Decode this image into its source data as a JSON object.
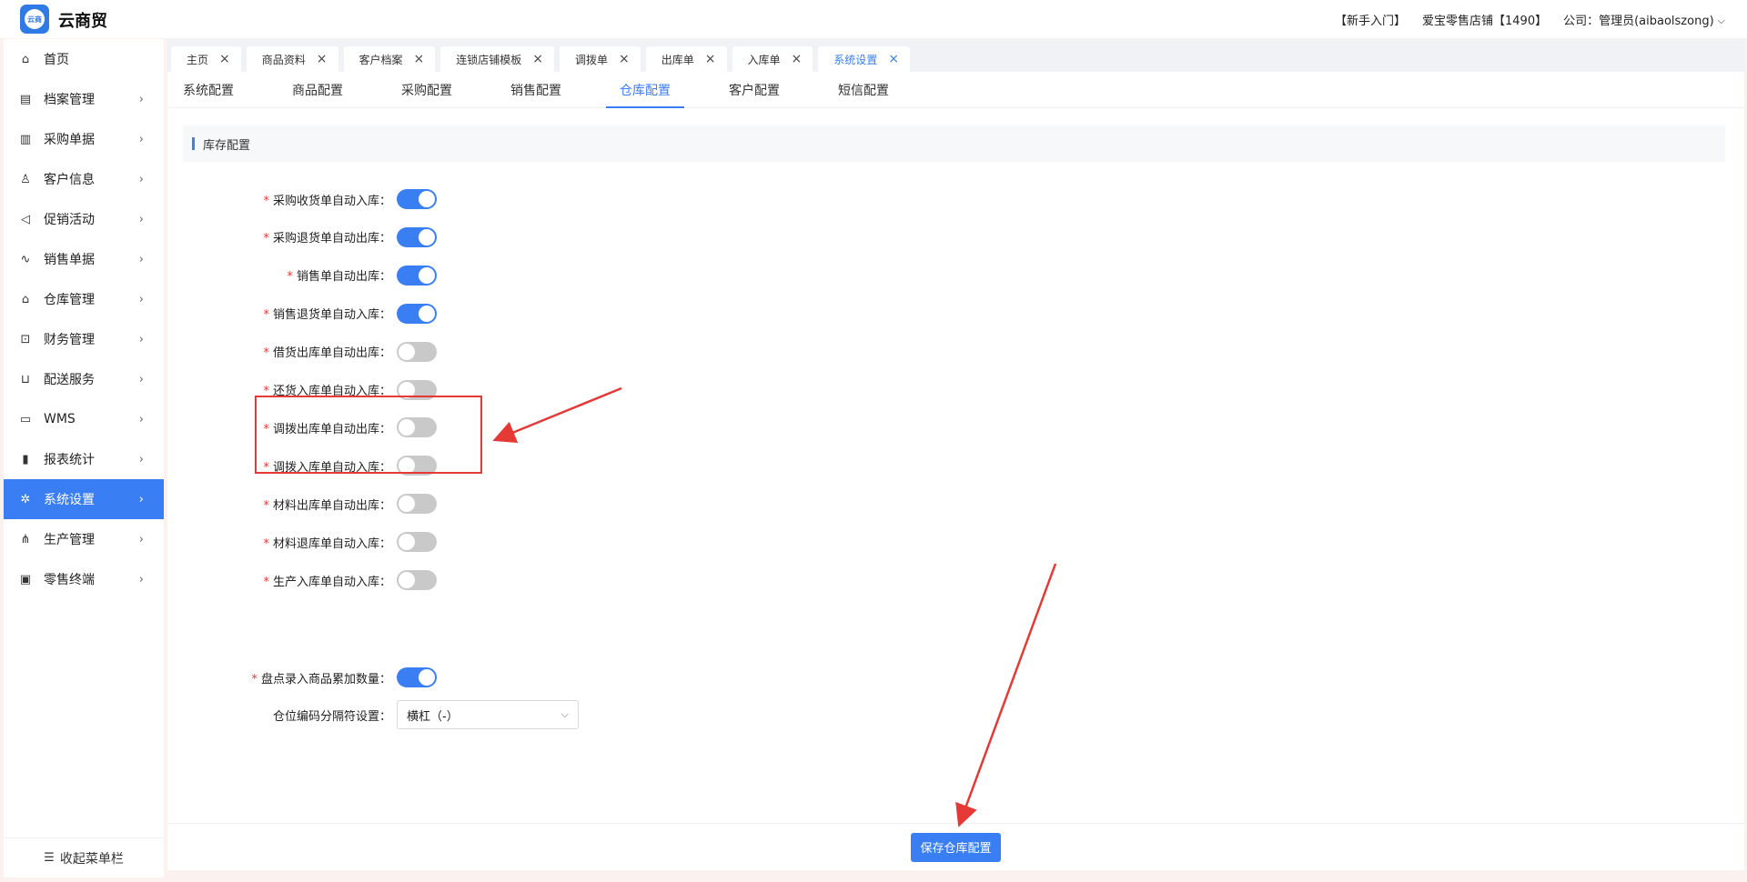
{
  "header": {
    "app_title": "云商贸",
    "logo_text": "云商",
    "newbie_link": "【新手入门】",
    "store": "爱宝零售店铺【1490】",
    "company": "公司：管理员(aibaolszong)",
    "dropdown_icon": "chevron-down-icon"
  },
  "sidebar": {
    "items": [
      {
        "label": "首页",
        "icon": "home-icon"
      },
      {
        "label": "档案管理",
        "icon": "archive-icon"
      },
      {
        "label": "采购单据",
        "icon": "purchase-doc-icon"
      },
      {
        "label": "客户信息",
        "icon": "user-icon"
      },
      {
        "label": "促销活动",
        "icon": "megaphone-icon"
      },
      {
        "label": "销售单据",
        "icon": "chart-line-icon"
      },
      {
        "label": "仓库管理",
        "icon": "warehouse-icon"
      },
      {
        "label": "财务管理",
        "icon": "finance-icon"
      },
      {
        "label": "配送服务",
        "icon": "cart-icon"
      },
      {
        "label": "WMS",
        "icon": "truck-icon"
      },
      {
        "label": "报表统计",
        "icon": "bar-chart-icon"
      },
      {
        "label": "系统设置",
        "icon": "gear-icon"
      },
      {
        "label": "生产管理",
        "icon": "network-icon"
      },
      {
        "label": "零售终端",
        "icon": "bag-icon"
      }
    ],
    "active_index": 11,
    "collapse_label": "收起菜单栏"
  },
  "tabs": [
    {
      "label": "主页"
    },
    {
      "label": "商品资料"
    },
    {
      "label": "客户档案"
    },
    {
      "label": "连锁店铺模板"
    },
    {
      "label": "调拨单"
    },
    {
      "label": "出库单"
    },
    {
      "label": "入库单"
    },
    {
      "label": "系统设置"
    }
  ],
  "active_tab": 7,
  "subtabs": [
    "系统配置",
    "商品配置",
    "采购配置",
    "销售配置",
    "仓库配置",
    "客户配置",
    "短信配置"
  ],
  "active_subtab": 4,
  "section_title": "库存配置",
  "settings": [
    {
      "label": "采购收货单自动入库：",
      "required": true,
      "on": true
    },
    {
      "label": "采购退货单自动出库：",
      "required": true,
      "on": true
    },
    {
      "label": "销售单自动出库：",
      "required": true,
      "on": true
    },
    {
      "label": "销售退货单自动入库：",
      "required": true,
      "on": true
    },
    {
      "label": "借货出库单自动出库：",
      "required": true,
      "on": false
    },
    {
      "label": "还货入库单自动入库：",
      "required": true,
      "on": false
    },
    {
      "label": "调拨出库单自动出库：",
      "required": true,
      "on": false
    },
    {
      "label": "调拨入库单自动入库：",
      "required": true,
      "on": false
    },
    {
      "label": "材料出库单自动出库：",
      "required": true,
      "on": false
    },
    {
      "label": "材料退库单自动入库：",
      "required": true,
      "on": false
    },
    {
      "label": "生产入库单自动入库：",
      "required": true,
      "on": false
    },
    {
      "label": "盘点录入商品累加数量：",
      "required": true,
      "on": true
    }
  ],
  "separator_setting": {
    "label": "仓位编码分隔符设置：",
    "value": "横杠（-）"
  },
  "save_button": "保存仓库配置",
  "colors": {
    "accent": "#3a7ef3",
    "annotation": "#e53935"
  }
}
